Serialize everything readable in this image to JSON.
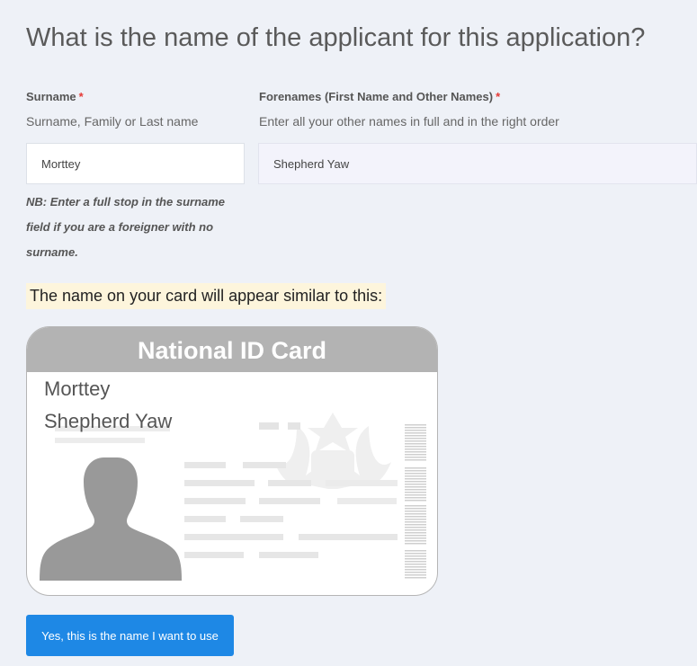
{
  "page": {
    "title": "What is the name of the applicant for this application?"
  },
  "surname": {
    "label": "Surname",
    "required_marker": "*",
    "help": "Surname, Family or Last name",
    "value": "Morttey",
    "note": "NB: Enter a full stop in the surname field if you are a foreigner with no surname."
  },
  "forenames": {
    "label": "Forenames (First Name and Other Names)",
    "required_marker": "*",
    "help": "Enter all your other names in full and in the right order",
    "value": "Shepherd Yaw"
  },
  "preview": {
    "text": "The name on your card will appear similar to this:"
  },
  "card": {
    "header": "National ID Card",
    "surname": "Morttey",
    "forenames": "Shepherd Yaw",
    "icons": [
      "person-silhouette-icon",
      "coat-of-arms-icon"
    ]
  },
  "actions": {
    "confirm_label": "Yes, this is the name I want to use"
  },
  "colors": {
    "background": "#eef1f7",
    "button": "#1e88e5",
    "required": "#e53935",
    "preview_highlight": "#fdf5dc",
    "card_header": "#b3b3b3"
  }
}
